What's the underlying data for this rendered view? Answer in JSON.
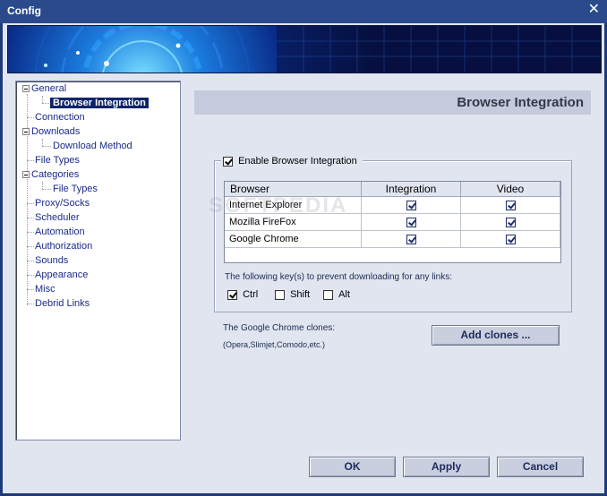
{
  "window": {
    "title": "Config",
    "close_glyph": "✕"
  },
  "tree": {
    "items": [
      {
        "label": "General"
      },
      {
        "label": "Browser Integration"
      },
      {
        "label": "Connection"
      },
      {
        "label": "Downloads"
      },
      {
        "label": "Download Method"
      },
      {
        "label": "File Types"
      },
      {
        "label": "Categories"
      },
      {
        "label": "File Types"
      },
      {
        "label": "Proxy/Socks"
      },
      {
        "label": "Scheduler"
      },
      {
        "label": "Automation"
      },
      {
        "label": "Authorization"
      },
      {
        "label": "Sounds"
      },
      {
        "label": "Appearance"
      },
      {
        "label": "Misc"
      },
      {
        "label": "Debrid Links"
      }
    ],
    "selected": "Browser Integration"
  },
  "panel": {
    "header": "Browser Integration"
  },
  "integration": {
    "enable_label": "Enable Browser Integration",
    "enabled": true,
    "columns": [
      "Browser",
      "Integration",
      "Video"
    ],
    "rows": [
      {
        "browser": "Internet Explorer",
        "integration": true,
        "video": true
      },
      {
        "browser": "Mozilla FireFox",
        "integration": true,
        "video": true
      },
      {
        "browser": "Google Chrome",
        "integration": true,
        "video": true
      }
    ],
    "keys_label": "The following key(s) to prevent downloading for any links:",
    "keys": [
      {
        "label": "Ctrl",
        "checked": true
      },
      {
        "label": "Shift",
        "checked": false
      },
      {
        "label": "Alt",
        "checked": false
      }
    ]
  },
  "clones": {
    "label": "The Google Chrome clones:",
    "examples": "(Opera,Slimjet,Comodo,etc.)",
    "button": "Add clones ..."
  },
  "buttons": {
    "ok": "OK",
    "apply": "Apply",
    "cancel": "Cancel"
  },
  "watermark": "SOFTPEDIA",
  "colors": {
    "titlebar": "#2a4a8c",
    "selection": "#0a246a",
    "client": "#e1e5f0",
    "tree_text": "#1a2a8a"
  }
}
